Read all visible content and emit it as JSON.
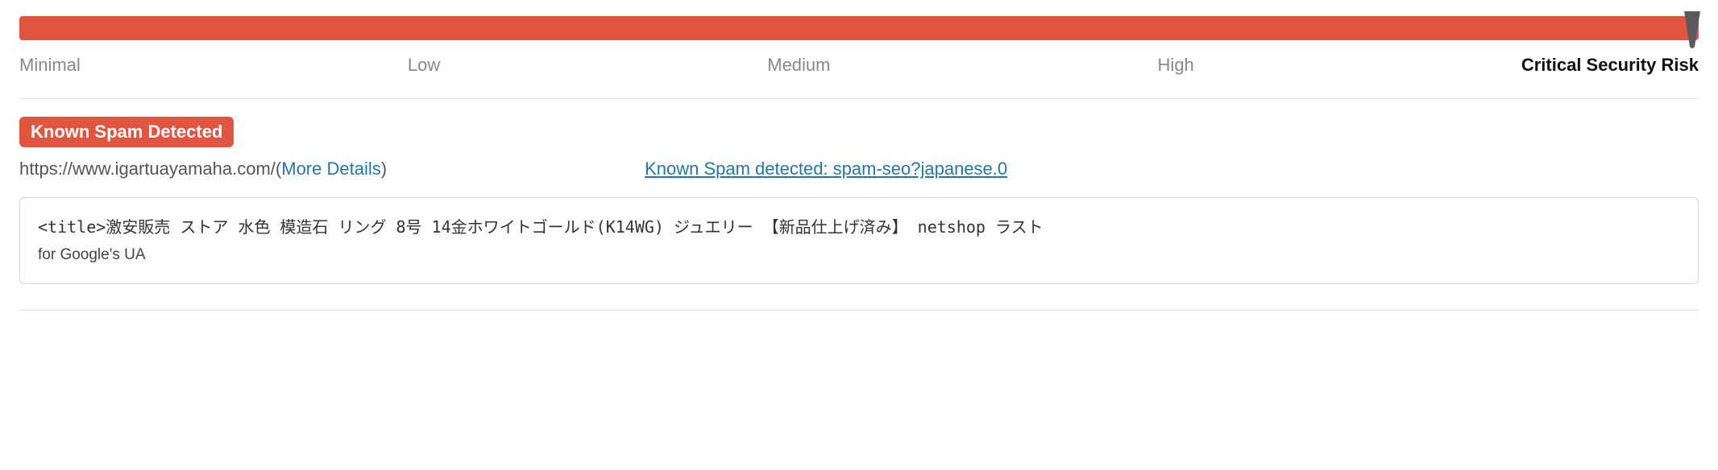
{
  "risk": {
    "labels": {
      "minimal": "Minimal",
      "low": "Low",
      "medium": "Medium",
      "high": "High",
      "critical": "Critical Security Risk"
    },
    "active": "critical"
  },
  "detection": {
    "badge_label": "Known Spam Detected",
    "url": "https://www.igartuayamaha.com/",
    "more_details_label": "More Details",
    "open_paren": " (",
    "close_paren": ")",
    "detection_link": "Known Spam detected: spam-seo?japanese.0"
  },
  "code": {
    "line1": "<title>激安販売 ストア 水色 模造石 リング 8号 14金ホワイトゴールド(K14WG) ジュエリー 【新品仕上げ済み】 netshop ラスト",
    "note": "for Google's UA"
  }
}
